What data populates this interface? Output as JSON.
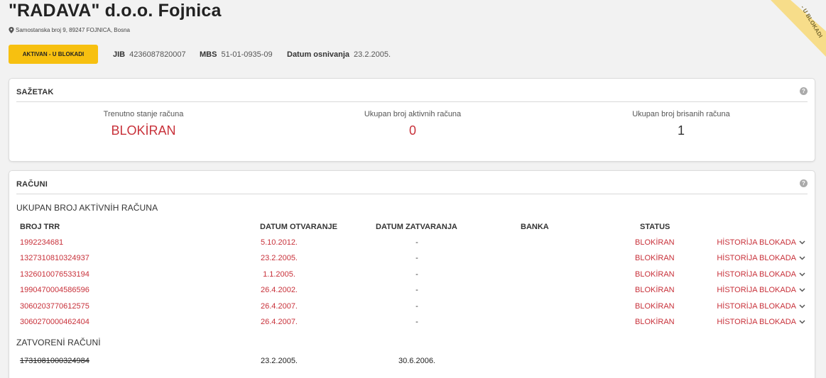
{
  "company": {
    "title": "\"RADAVA\" d.o.o. Fojnica",
    "address": "Samostanska broj 9, 89247 FOJNICA, Bosna",
    "status_button": "AKTIVAN - U BLOKADI",
    "ribbon": "- U BLOKADI",
    "jib_label": "JIB",
    "jib": "4236087820007",
    "mbs_label": "MBS",
    "mbs": "51-01-0935-09",
    "founded_label": "Datum osnivanja",
    "founded": "23.2.2005."
  },
  "summary": {
    "title": "SAŽETAK",
    "help": "?",
    "items": [
      {
        "label": "Trenutno stanje računa",
        "value": "BLOKİRAN"
      },
      {
        "label": "Ukupan broj aktivnih računa",
        "value": "0"
      },
      {
        "label": "Ukupan broj brisanih računa",
        "value": "1"
      }
    ]
  },
  "accounts": {
    "title": "RAČUNI",
    "help": "?",
    "active_heading": "UKUPAN BROJ AKTİVNİH RAČUNA",
    "columns": [
      "BROJ TRR",
      "DATUM OTVARANJE",
      "DATUM ZATVARANJA",
      "BANKA",
      "STATUS"
    ],
    "history_label": "HİSTORİJA BLOKADA",
    "active_rows": [
      {
        "trr": "1992234681",
        "opened": "5.10.2012.",
        "closed": "-",
        "status": "BLOKİRAN"
      },
      {
        "trr": "1327310810324937",
        "opened": "23.2.2005.",
        "closed": "-",
        "status": "BLOKİRAN"
      },
      {
        "trr": "1326010076533194",
        "opened": "1.1.2005.",
        "closed": "-",
        "status": "BLOKİRAN"
      },
      {
        "trr": "1990470004586596",
        "opened": "26.4.2002.",
        "closed": "-",
        "status": "BLOKİRAN"
      },
      {
        "trr": "3060203770612575",
        "opened": "26.4.2007.",
        "closed": "-",
        "status": "BLOKİRAN"
      },
      {
        "trr": "3060270000462404",
        "opened": "26.4.2007.",
        "closed": "-",
        "status": "BLOKİRAN"
      }
    ],
    "closed_heading": "ZATVORENİ RAČUNİ",
    "closed_rows": [
      {
        "trr": "1731081000324984",
        "opened": "23.2.2005.",
        "closed": "30.6.2006."
      }
    ]
  },
  "colors": {
    "accent_red": "#c8313a",
    "status_yellow": "#f7c010",
    "ribbon": "#f7dd8a"
  }
}
